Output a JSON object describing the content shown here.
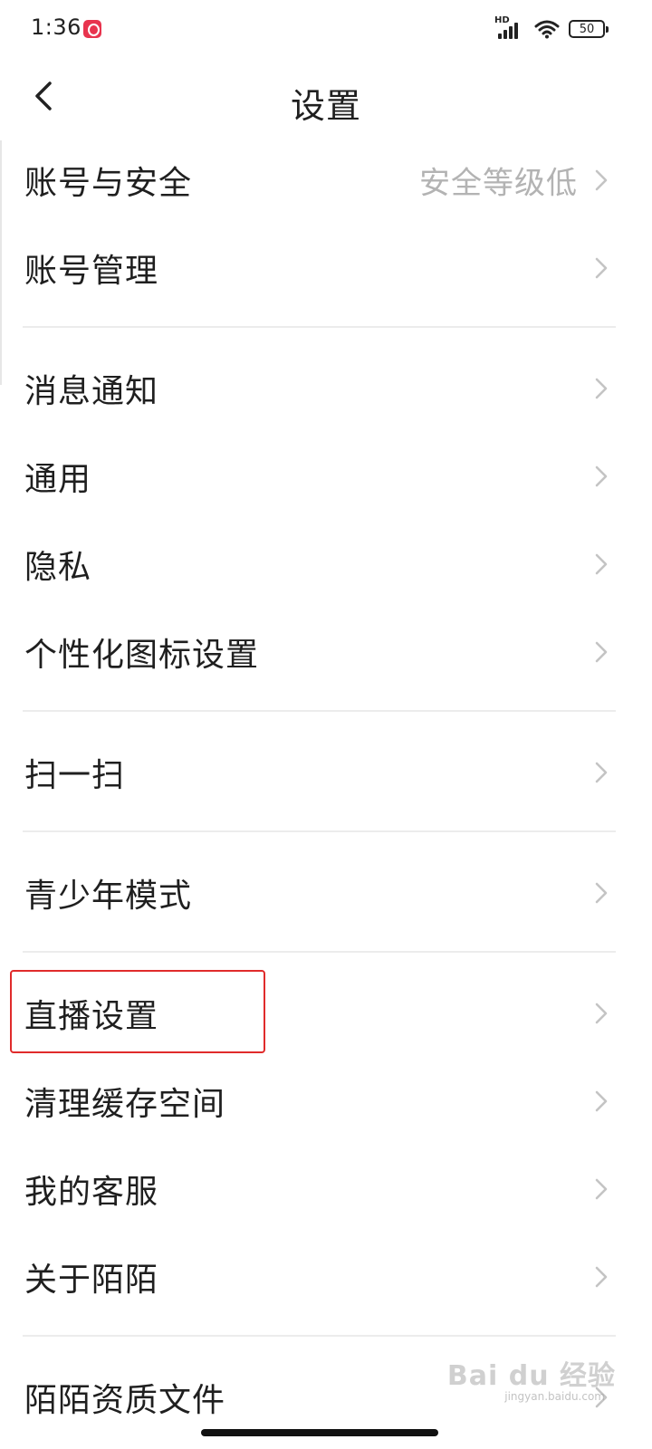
{
  "status_bar": {
    "time": "1:36",
    "network_label": "HD",
    "battery": "50",
    "icons": [
      "app-notification-icon",
      "signal-icon",
      "wifi-icon",
      "battery-icon"
    ]
  },
  "header": {
    "title": "设置",
    "back_icon": "chevron-left-icon"
  },
  "sections": [
    {
      "items": [
        {
          "label": "账号与安全",
          "value": "安全等级低"
        },
        {
          "label": "账号管理"
        }
      ]
    },
    {
      "items": [
        {
          "label": "消息通知"
        },
        {
          "label": "通用"
        },
        {
          "label": "隐私"
        },
        {
          "label": "个性化图标设置"
        }
      ]
    },
    {
      "items": [
        {
          "label": "扫一扫"
        }
      ]
    },
    {
      "items": [
        {
          "label": "青少年模式"
        }
      ]
    },
    {
      "items": [
        {
          "label": "直播设置",
          "highlighted": true
        },
        {
          "label": "清理缓存空间"
        },
        {
          "label": "我的客服"
        },
        {
          "label": "关于陌陌"
        }
      ]
    },
    {
      "items": [
        {
          "label": "陌陌资质文件"
        }
      ]
    }
  ],
  "highlight_color": "#e02b2b",
  "watermark": {
    "text": "Bai du 经验",
    "sub": "jingyan.baidu.com"
  }
}
